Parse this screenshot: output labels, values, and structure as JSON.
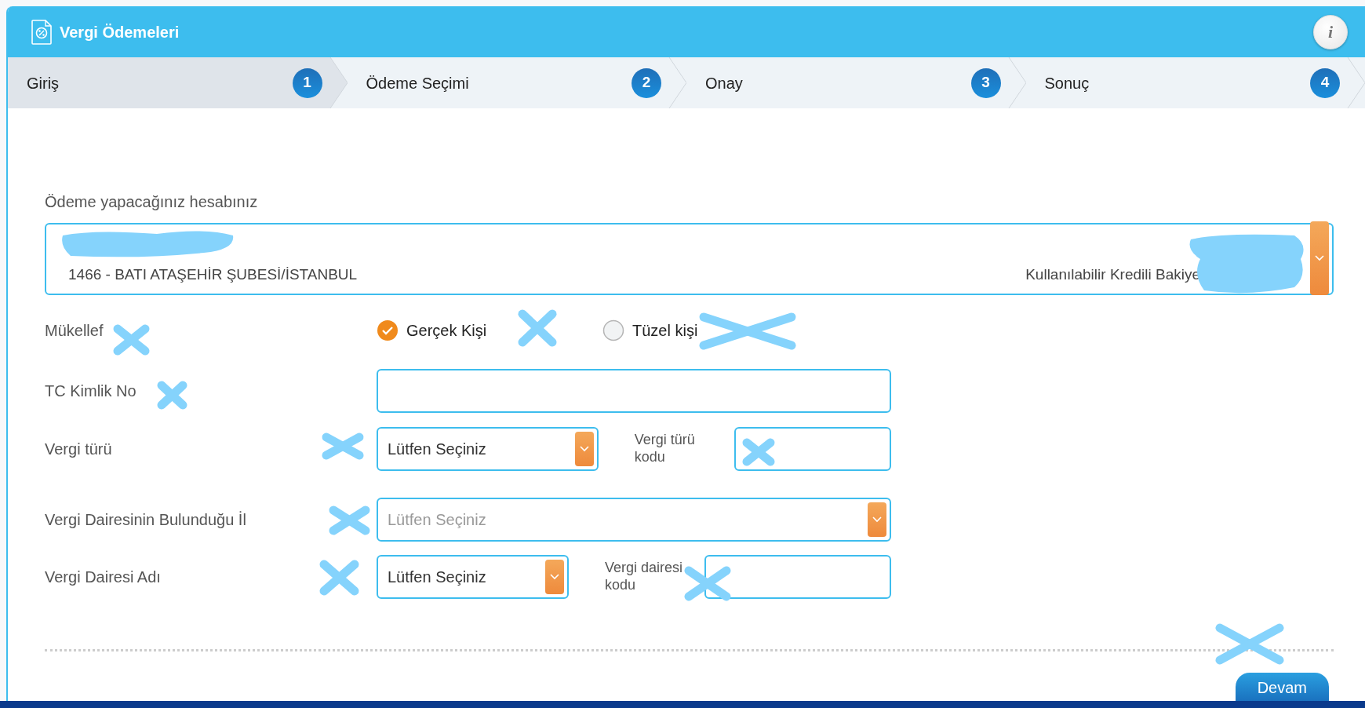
{
  "header": {
    "title": "Vergi Ödemeleri",
    "info_button": "i"
  },
  "steps": [
    {
      "label": "Giriş",
      "number": "1",
      "selected": true
    },
    {
      "label": "Ödeme Seçimi",
      "number": "2",
      "selected": false
    },
    {
      "label": "Onay",
      "number": "3",
      "selected": false
    },
    {
      "label": "Sonuç",
      "number": "4",
      "selected": false
    }
  ],
  "account": {
    "label": "Ödeme yapacağınız hesabınız",
    "branch": "1466 - BATI ATAŞEHİR ŞUBESİ/İSTANBUL",
    "balance_label": "Kullanılabilir Kredili Bakiye"
  },
  "taxpayer": {
    "label": "Mükellef",
    "options": [
      {
        "label": "Gerçek Kişi",
        "selected": true
      },
      {
        "label": "Tüzel kişi",
        "selected": false
      }
    ]
  },
  "fields": [
    {
      "kind": "text",
      "label": "TC Kimlik No"
    },
    {
      "kind": "select-code",
      "label": "Vergi türü",
      "value": "Lütfen Seçiniz",
      "code_label": "Vergi türü kodu"
    },
    {
      "kind": "select",
      "label": "Vergi Dairesinin Bulunduğu İl",
      "placeholder": "Lütfen Seçiniz"
    },
    {
      "kind": "select-code",
      "label": "Vergi Dairesi Adı",
      "value": "Lütfen Seçiniz",
      "code_label": "Vergi dairesi kodu"
    }
  ],
  "buttons": [
    {
      "label": "Devam"
    }
  ]
}
